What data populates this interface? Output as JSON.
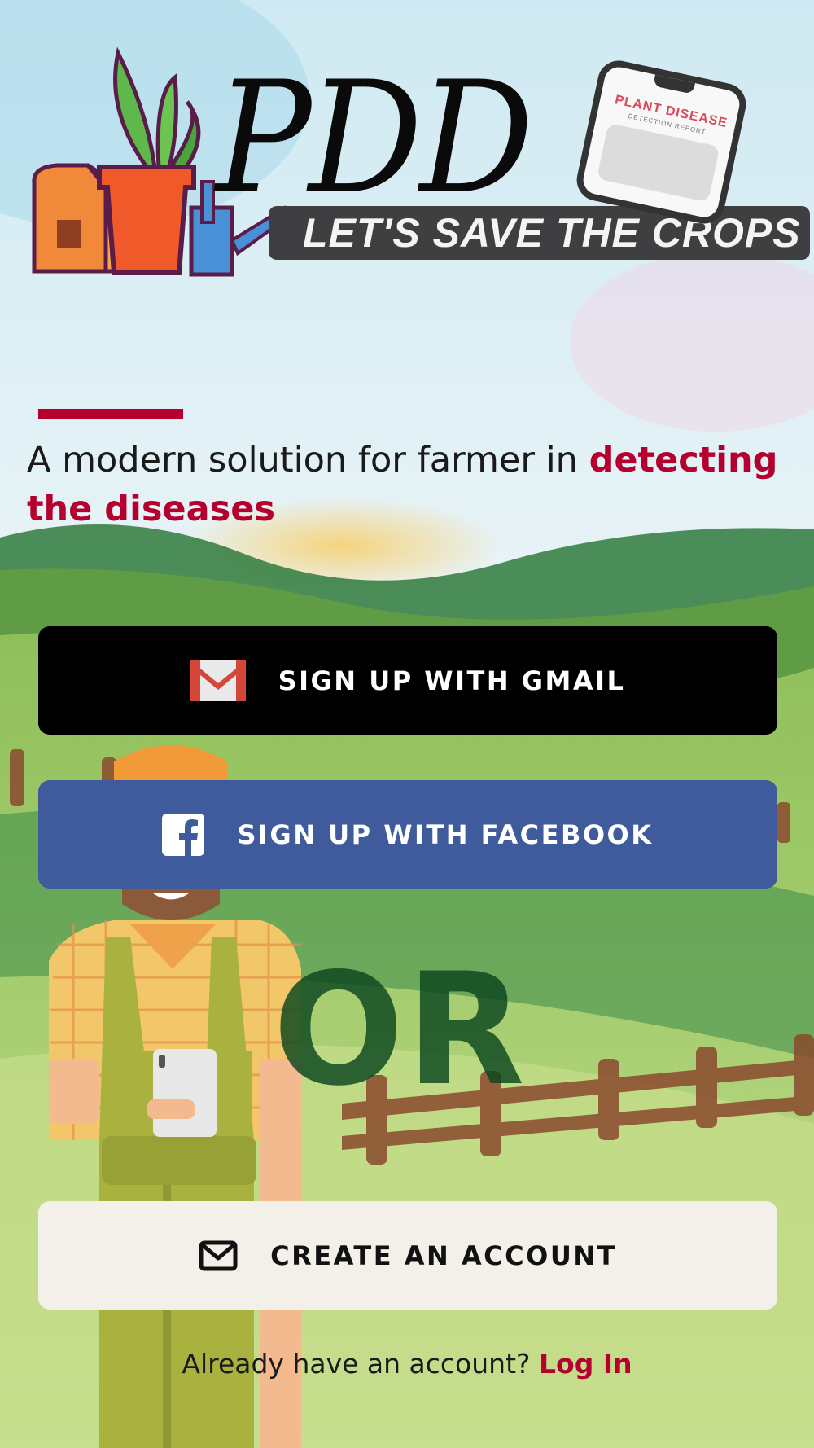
{
  "logo": {
    "wordmark": "PDD",
    "banner": "LET'S SAVE THE CROPS",
    "phone_title": "PLANT DISEASE",
    "phone_subtitle": "DETECTION REPORT"
  },
  "tagline": {
    "plain": "A modern solution for farmer in ",
    "highlight": "detecting the diseases"
  },
  "buttons": {
    "gmail": {
      "label": "SIGN UP WITH GMAIL",
      "icon": "gmail-icon"
    },
    "facebook": {
      "label": "SIGN UP WITH FACEBOOK",
      "icon": "facebook-icon"
    },
    "create": {
      "label": "CREATE AN ACCOUNT",
      "icon": "mail-icon"
    }
  },
  "divider_text": "OR",
  "login": {
    "prompt": "Already have an account? ",
    "link": "Log In"
  },
  "colors": {
    "accent": "#b5002f",
    "gmail_button": "#000000",
    "facebook_button": "#3f5b9c",
    "create_button": "#f3efe9",
    "or_text": "#0a461e"
  }
}
